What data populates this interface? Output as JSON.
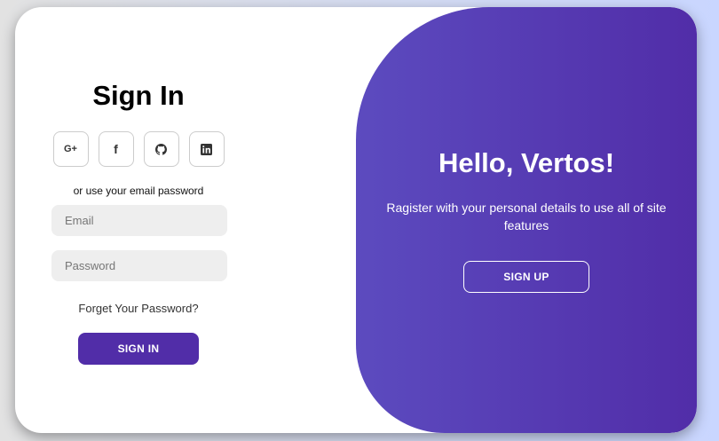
{
  "sign_in": {
    "title": "Sign In",
    "social_icons": [
      "google-plus-icon",
      "facebook-icon",
      "github-icon",
      "linkedin-icon"
    ],
    "social_labels": {
      "google": "G+",
      "facebook": "f"
    },
    "subtitle": "or use your email password",
    "email_placeholder": "Email",
    "password_placeholder": "Password",
    "forgot_link": "Forget Your Password?",
    "button_label": "SIGN IN"
  },
  "toggle": {
    "title": "Hello, Vertos!",
    "description": "Ragister with your personal details to use all of site features",
    "button_label": "SIGN UP"
  },
  "colors": {
    "accent": "#512da8",
    "panel_gradient_start": "#5c4bbf",
    "input_bg": "#eeeeee"
  }
}
